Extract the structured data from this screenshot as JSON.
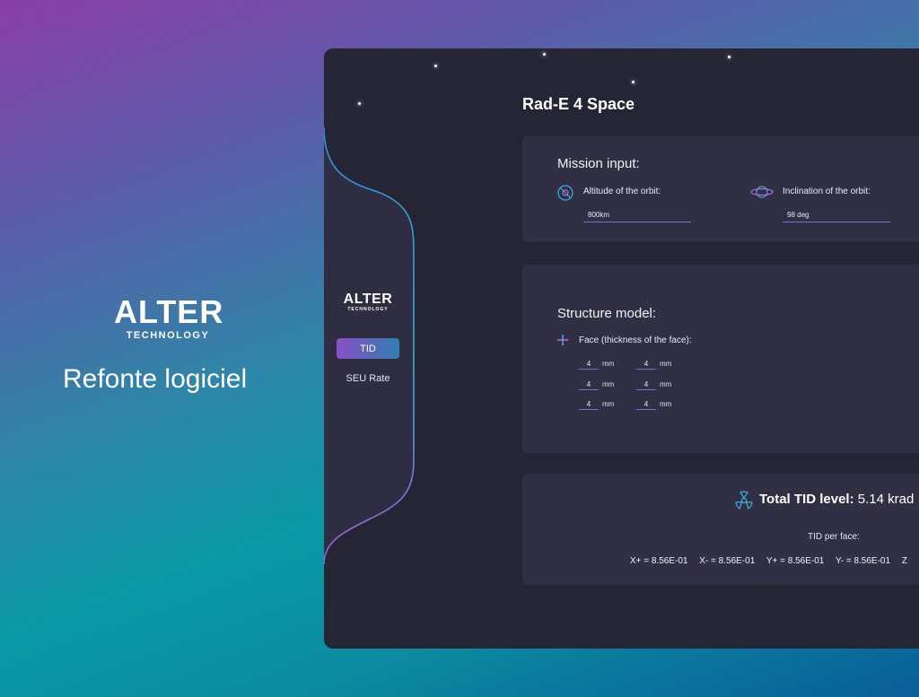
{
  "promo": {
    "logo_word": "ALTER",
    "logo_sub": "TECHNOLOGY",
    "tagline": "Refonte logiciel"
  },
  "sidebar": {
    "logo_word": "ALTER",
    "logo_sub": "TECHNOLOGY",
    "items": [
      {
        "label": "TID",
        "active": true
      },
      {
        "label": "SEU Rate",
        "active": false
      }
    ],
    "accent_gradient": [
      "#3aa0e0",
      "#a05ad8"
    ]
  },
  "app": {
    "title": "Rad-E 4 Space"
  },
  "mission": {
    "title": "Mission input:",
    "altitude": {
      "label": "Altitude of the orbit:",
      "value": "800km",
      "icon": "orbit-satellite-icon"
    },
    "inclination": {
      "label": "Inclination of the orbit:",
      "value": "98 deg",
      "icon": "planet-ring-icon"
    }
  },
  "structure": {
    "title": "Structure model:",
    "face_label": "Face (thickness of the face):",
    "face_icon": "cross-axis-icon",
    "unit": "mm",
    "rows": [
      [
        "4",
        "4"
      ],
      [
        "4",
        "4"
      ],
      [
        "4",
        "4"
      ]
    ]
  },
  "result": {
    "total_label": "Total TID level:",
    "total_value": "5.14 krad",
    "icon": "radiation-icon",
    "per_face_label": "TID per face:",
    "faces": [
      "X+ = 8.56E-01",
      "X- = 8.56E-01",
      "Y+ = 8.56E-01",
      "Y- = 8.56E-01",
      "Z"
    ]
  },
  "colors": {
    "app_bg": "#262536",
    "card_bg": "#302f44",
    "input_underline": "#7d6bd6"
  }
}
